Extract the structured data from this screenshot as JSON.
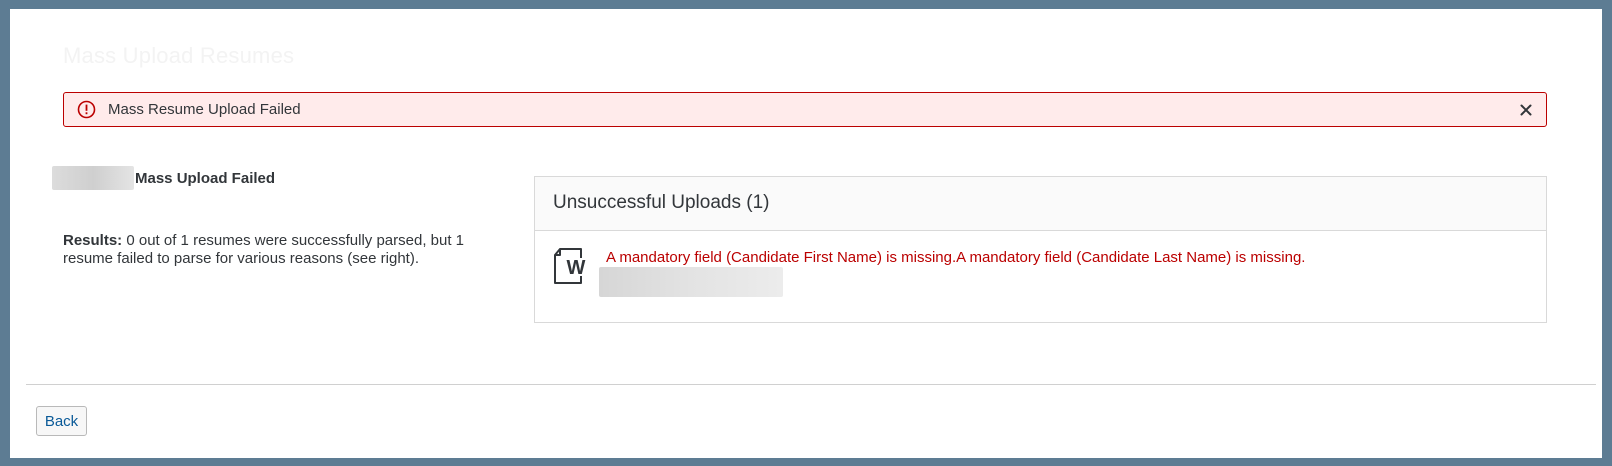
{
  "dialog": {
    "title": "Mass Upload Resumes"
  },
  "error_strip": {
    "icon": "error-circle-icon",
    "message": "Mass Resume Upload Failed",
    "close_icon": "close-icon",
    "colors": {
      "border": "#bb0000",
      "background": "#ffebeb"
    }
  },
  "summary": {
    "status_heading": "Mass Upload Failed",
    "results_label": "Results:",
    "results_text": " 0 out of 1 resumes were successfully parsed, but 1 resume failed to parse for various reasons (see right)."
  },
  "unsuccessful_panel": {
    "title": "Unsuccessful Uploads (1)",
    "items": [
      {
        "icon": "word-document-icon",
        "error": "A mandatory field (Candidate First Name) is missing.A mandatory field (Candidate Last Name) is missing."
      }
    ]
  },
  "footer": {
    "back_label": "Back"
  },
  "colors": {
    "accent": "#0a5a98",
    "error": "#bb0000",
    "frame": "#5d7c93"
  }
}
